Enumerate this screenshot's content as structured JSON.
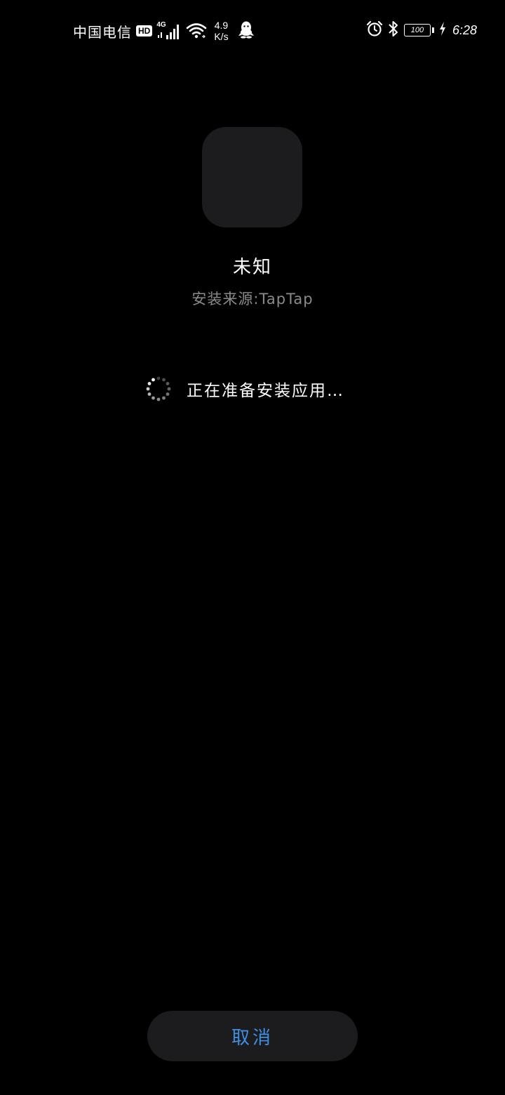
{
  "status_bar": {
    "carrier": "中国电信",
    "hd_label": "HD",
    "network_type": "4G",
    "speed_value": "4.9",
    "speed_unit": "K/s",
    "battery_level": "100",
    "time": "6:28",
    "icons": [
      "hd-icon",
      "signal-icon",
      "wifi-icon",
      "qq-icon",
      "alarm-icon",
      "bluetooth-icon",
      "battery-icon",
      "charging-icon"
    ]
  },
  "app": {
    "name": "未知",
    "install_source": "安装来源:TapTap"
  },
  "progress": {
    "text": "正在准备安装应用…"
  },
  "actions": {
    "cancel_label": "取消"
  },
  "colors": {
    "background": "#000000",
    "surface": "#1c1c1e",
    "accent": "#3e8ee4",
    "secondary_text": "#8a8a8a"
  }
}
